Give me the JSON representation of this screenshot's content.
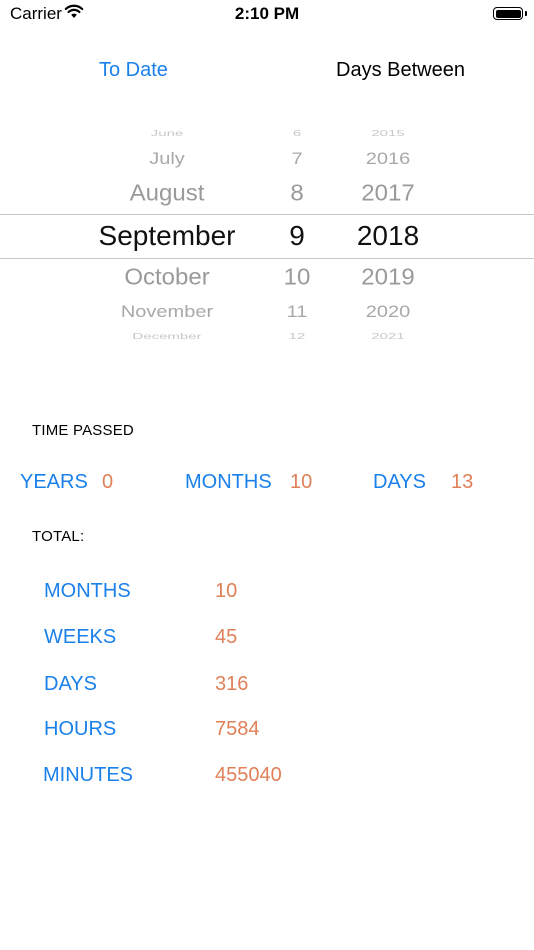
{
  "status_bar": {
    "carrier": "Carrier",
    "time": "2:10 PM"
  },
  "tabs": {
    "to_date": "To Date",
    "days_between": "Days Between"
  },
  "picker": {
    "months": [
      "June",
      "July",
      "August",
      "September",
      "October",
      "November",
      "December"
    ],
    "days": [
      "6",
      "7",
      "8",
      "9",
      "10",
      "11",
      "12"
    ],
    "years": [
      "2015",
      "2016",
      "2017",
      "2018",
      "2019",
      "2020",
      "2021"
    ],
    "selected_index": 3
  },
  "time_passed": {
    "title": "TIME PASSED",
    "years_label": "YEARS",
    "years_value": "0",
    "months_label": "MONTHS",
    "months_value": "10",
    "days_label": "DAYS",
    "days_value": "13"
  },
  "total": {
    "title": "TOTAL:",
    "rows": [
      {
        "label": "MONTHS",
        "value": "10"
      },
      {
        "label": "WEEKS",
        "value": "45"
      },
      {
        "label": "DAYS",
        "value": "316"
      },
      {
        "label": "HOURS",
        "value": "7584"
      },
      {
        "label": "MINUTES",
        "value": "455040"
      }
    ]
  },
  "colors": {
    "accent_blue": "#1a80ea",
    "value_orange": "#e08058"
  }
}
